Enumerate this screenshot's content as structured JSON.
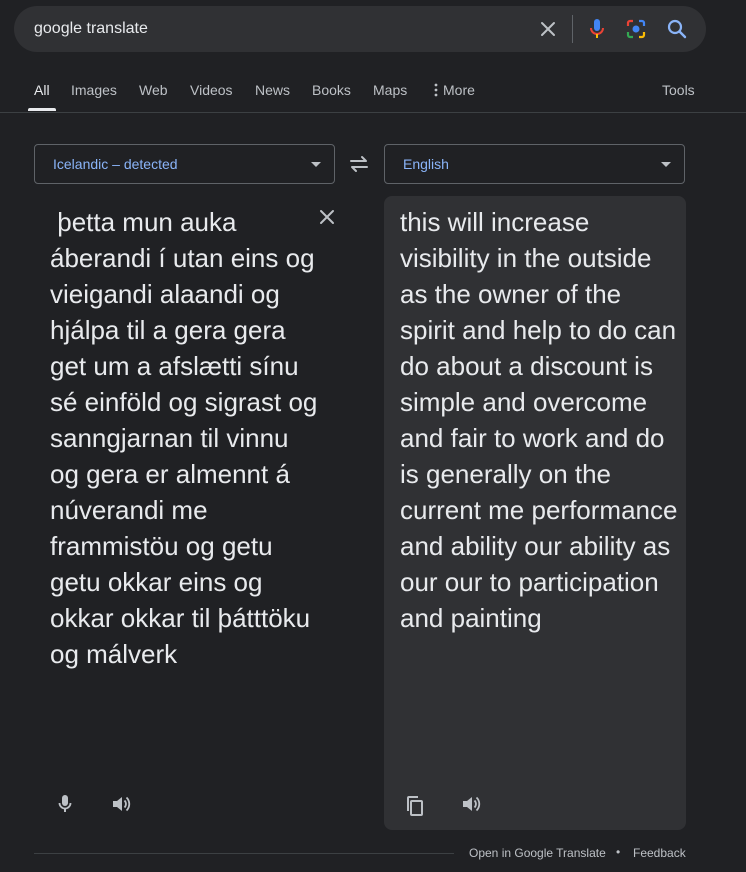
{
  "search": {
    "query": "google translate"
  },
  "tabs": [
    {
      "label": "All"
    },
    {
      "label": "Images"
    },
    {
      "label": "Web"
    },
    {
      "label": "Videos"
    },
    {
      "label": "News"
    },
    {
      "label": "Books"
    },
    {
      "label": "Maps"
    },
    {
      "label": "More"
    }
  ],
  "tools_label": "Tools",
  "translate": {
    "source_language": "Icelandic – detected",
    "target_language": "English",
    "source_text": " þetta mun auka áberandi í utan eins og vieigandi alaandi og hjálpa til a gera gera get um a afslætti sínu sé einföld og sigrast og sanngjarnan til vinnu og gera er almennt á núverandi me frammistöu og getu getu okkar eins og okkar okkar til þátttöku og málverk",
    "translated_text": "this will increase visibility in the outside as the owner of the spirit and help to do can do about a discount is simple and overcome and fair to work and do is generally on the current me performance and ability our ability as our our to participation and painting"
  },
  "footer": {
    "open_link": "Open in Google Translate",
    "separator": "•",
    "feedback": "Feedback"
  },
  "colors": {
    "background": "#202124",
    "panel": "#303134",
    "accent_link": "#8ab4f8",
    "text": "#e8eaed",
    "muted": "#bdc1c6"
  }
}
